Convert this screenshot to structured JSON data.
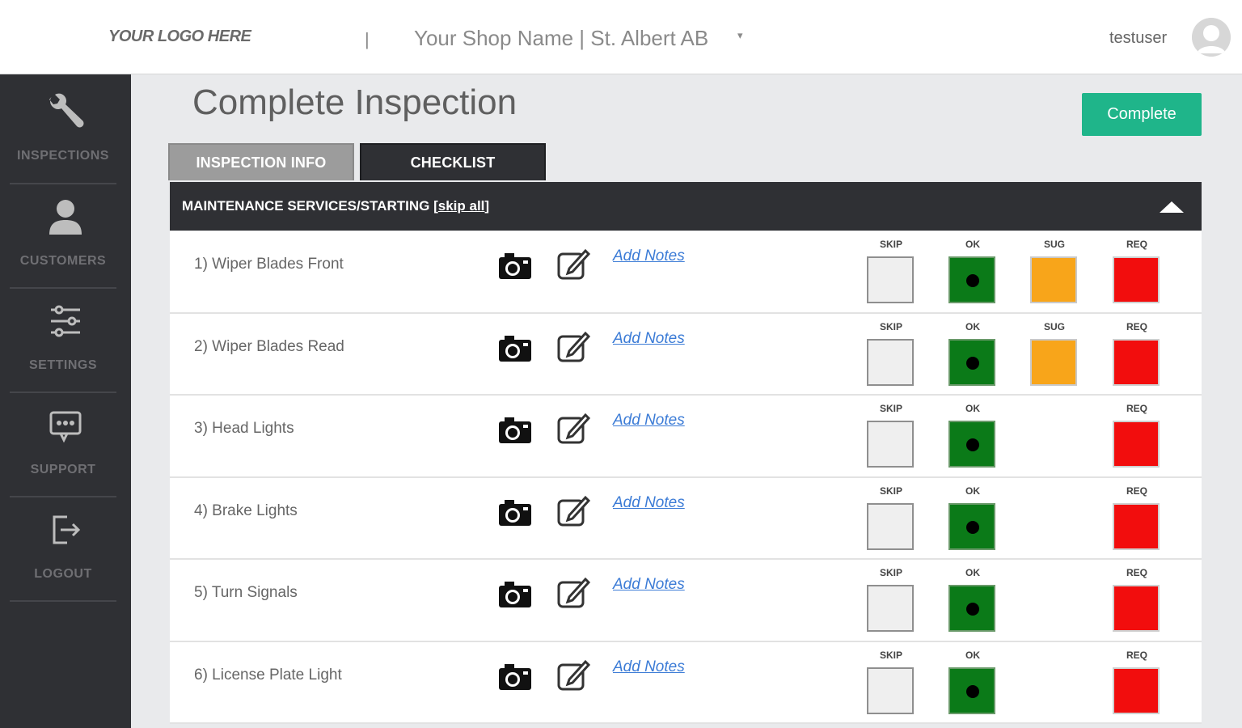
{
  "header": {
    "logo": "YOUR LOGO HERE",
    "separator": "|",
    "shop_name": "Your Shop Name | St. Albert AB",
    "shop_caret": "▾",
    "username": "testuser"
  },
  "sidebar": {
    "items": [
      {
        "label": "INSPECTIONS",
        "icon": "wrench-icon"
      },
      {
        "label": "CUSTOMERS",
        "icon": "user-icon"
      },
      {
        "label": "SETTINGS",
        "icon": "sliders-icon"
      },
      {
        "label": "SUPPORT",
        "icon": "chat-icon"
      },
      {
        "label": "LOGOUT",
        "icon": "logout-icon"
      }
    ]
  },
  "main": {
    "title": "Complete Inspection",
    "complete_label": "Complete",
    "tabs": [
      {
        "label": "INSPECTION INFO",
        "active": false
      },
      {
        "label": "CHECKLIST",
        "active": true
      }
    ],
    "section": {
      "title": "MAINTENANCE SERVICES/STARTING",
      "skip_prefix": "[",
      "skip_label": "skip all",
      "skip_suffix": "]"
    },
    "option_labels": {
      "skip": "SKIP",
      "ok": "OK",
      "sug": "SUG",
      "req": "REQ"
    },
    "add_notes_label": "Add Notes",
    "items": [
      {
        "name": "1) Wiper Blades Front",
        "has_sug": true,
        "selected": "ok"
      },
      {
        "name": "2) Wiper Blades Read",
        "has_sug": true,
        "selected": "ok"
      },
      {
        "name": "3) Head Lights",
        "has_sug": false,
        "selected": "ok"
      },
      {
        "name": "4) Brake Lights",
        "has_sug": false,
        "selected": "ok"
      },
      {
        "name": "5) Turn Signals",
        "has_sug": false,
        "selected": "ok"
      },
      {
        "name": "6) License Plate Light",
        "has_sug": false,
        "selected": "ok"
      }
    ]
  },
  "colors": {
    "accent": "#1fb58a",
    "sidebar_bg": "#2f3034",
    "ok": "#0b7a18",
    "sug": "#f8a51a",
    "req": "#f20d0d",
    "link": "#3b7bd6"
  }
}
